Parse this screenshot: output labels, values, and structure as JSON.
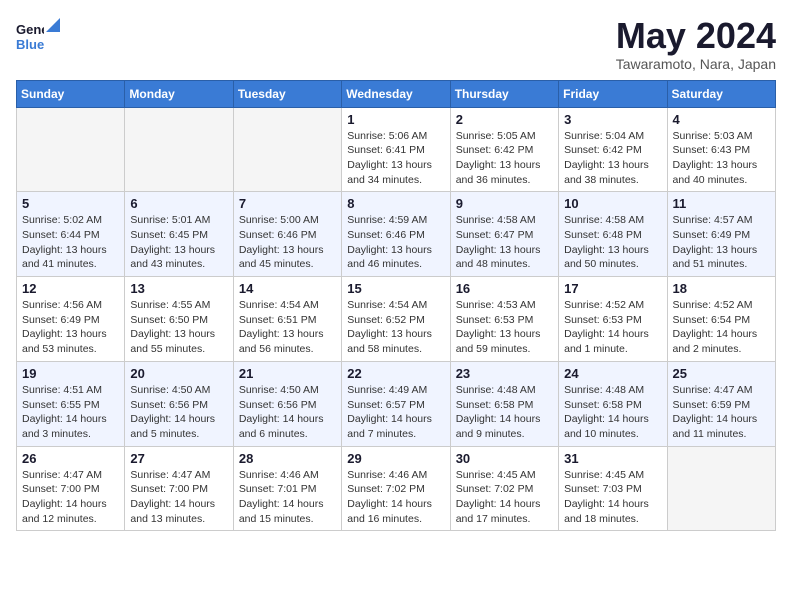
{
  "logo": {
    "line1": "General",
    "line2": "Blue"
  },
  "title": "May 2024",
  "location": "Tawaramoto, Nara, Japan",
  "weekdays": [
    "Sunday",
    "Monday",
    "Tuesday",
    "Wednesday",
    "Thursday",
    "Friday",
    "Saturday"
  ],
  "weeks": [
    [
      {
        "day": "",
        "info": ""
      },
      {
        "day": "",
        "info": ""
      },
      {
        "day": "",
        "info": ""
      },
      {
        "day": "1",
        "info": "Sunrise: 5:06 AM\nSunset: 6:41 PM\nDaylight: 13 hours\nand 34 minutes."
      },
      {
        "day": "2",
        "info": "Sunrise: 5:05 AM\nSunset: 6:42 PM\nDaylight: 13 hours\nand 36 minutes."
      },
      {
        "day": "3",
        "info": "Sunrise: 5:04 AM\nSunset: 6:42 PM\nDaylight: 13 hours\nand 38 minutes."
      },
      {
        "day": "4",
        "info": "Sunrise: 5:03 AM\nSunset: 6:43 PM\nDaylight: 13 hours\nand 40 minutes."
      }
    ],
    [
      {
        "day": "5",
        "info": "Sunrise: 5:02 AM\nSunset: 6:44 PM\nDaylight: 13 hours\nand 41 minutes."
      },
      {
        "day": "6",
        "info": "Sunrise: 5:01 AM\nSunset: 6:45 PM\nDaylight: 13 hours\nand 43 minutes."
      },
      {
        "day": "7",
        "info": "Sunrise: 5:00 AM\nSunset: 6:46 PM\nDaylight: 13 hours\nand 45 minutes."
      },
      {
        "day": "8",
        "info": "Sunrise: 4:59 AM\nSunset: 6:46 PM\nDaylight: 13 hours\nand 46 minutes."
      },
      {
        "day": "9",
        "info": "Sunrise: 4:58 AM\nSunset: 6:47 PM\nDaylight: 13 hours\nand 48 minutes."
      },
      {
        "day": "10",
        "info": "Sunrise: 4:58 AM\nSunset: 6:48 PM\nDaylight: 13 hours\nand 50 minutes."
      },
      {
        "day": "11",
        "info": "Sunrise: 4:57 AM\nSunset: 6:49 PM\nDaylight: 13 hours\nand 51 minutes."
      }
    ],
    [
      {
        "day": "12",
        "info": "Sunrise: 4:56 AM\nSunset: 6:49 PM\nDaylight: 13 hours\nand 53 minutes."
      },
      {
        "day": "13",
        "info": "Sunrise: 4:55 AM\nSunset: 6:50 PM\nDaylight: 13 hours\nand 55 minutes."
      },
      {
        "day": "14",
        "info": "Sunrise: 4:54 AM\nSunset: 6:51 PM\nDaylight: 13 hours\nand 56 minutes."
      },
      {
        "day": "15",
        "info": "Sunrise: 4:54 AM\nSunset: 6:52 PM\nDaylight: 13 hours\nand 58 minutes."
      },
      {
        "day": "16",
        "info": "Sunrise: 4:53 AM\nSunset: 6:53 PM\nDaylight: 13 hours\nand 59 minutes."
      },
      {
        "day": "17",
        "info": "Sunrise: 4:52 AM\nSunset: 6:53 PM\nDaylight: 14 hours\nand 1 minute."
      },
      {
        "day": "18",
        "info": "Sunrise: 4:52 AM\nSunset: 6:54 PM\nDaylight: 14 hours\nand 2 minutes."
      }
    ],
    [
      {
        "day": "19",
        "info": "Sunrise: 4:51 AM\nSunset: 6:55 PM\nDaylight: 14 hours\nand 3 minutes."
      },
      {
        "day": "20",
        "info": "Sunrise: 4:50 AM\nSunset: 6:56 PM\nDaylight: 14 hours\nand 5 minutes."
      },
      {
        "day": "21",
        "info": "Sunrise: 4:50 AM\nSunset: 6:56 PM\nDaylight: 14 hours\nand 6 minutes."
      },
      {
        "day": "22",
        "info": "Sunrise: 4:49 AM\nSunset: 6:57 PM\nDaylight: 14 hours\nand 7 minutes."
      },
      {
        "day": "23",
        "info": "Sunrise: 4:48 AM\nSunset: 6:58 PM\nDaylight: 14 hours\nand 9 minutes."
      },
      {
        "day": "24",
        "info": "Sunrise: 4:48 AM\nSunset: 6:58 PM\nDaylight: 14 hours\nand 10 minutes."
      },
      {
        "day": "25",
        "info": "Sunrise: 4:47 AM\nSunset: 6:59 PM\nDaylight: 14 hours\nand 11 minutes."
      }
    ],
    [
      {
        "day": "26",
        "info": "Sunrise: 4:47 AM\nSunset: 7:00 PM\nDaylight: 14 hours\nand 12 minutes."
      },
      {
        "day": "27",
        "info": "Sunrise: 4:47 AM\nSunset: 7:00 PM\nDaylight: 14 hours\nand 13 minutes."
      },
      {
        "day": "28",
        "info": "Sunrise: 4:46 AM\nSunset: 7:01 PM\nDaylight: 14 hours\nand 15 minutes."
      },
      {
        "day": "29",
        "info": "Sunrise: 4:46 AM\nSunset: 7:02 PM\nDaylight: 14 hours\nand 16 minutes."
      },
      {
        "day": "30",
        "info": "Sunrise: 4:45 AM\nSunset: 7:02 PM\nDaylight: 14 hours\nand 17 minutes."
      },
      {
        "day": "31",
        "info": "Sunrise: 4:45 AM\nSunset: 7:03 PM\nDaylight: 14 hours\nand 18 minutes."
      },
      {
        "day": "",
        "info": ""
      }
    ]
  ]
}
